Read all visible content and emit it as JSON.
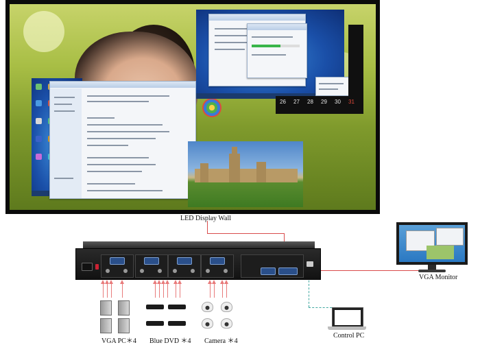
{
  "labels": {
    "wall": "LED Display Wall",
    "monitor": "VGA Monitor",
    "control": "Control PC",
    "vga_pc": "VGA PC＊4",
    "dvd": "Blue DVD ＊4",
    "camera": "Camera ＊4"
  },
  "wall_calendar": {
    "days": [
      "26",
      "27",
      "28",
      "29",
      "30",
      "31"
    ]
  },
  "colors": {
    "signal_line": "#d94b4b",
    "control_line": "#3fa7a0",
    "chassis": "#1a1a1a"
  }
}
